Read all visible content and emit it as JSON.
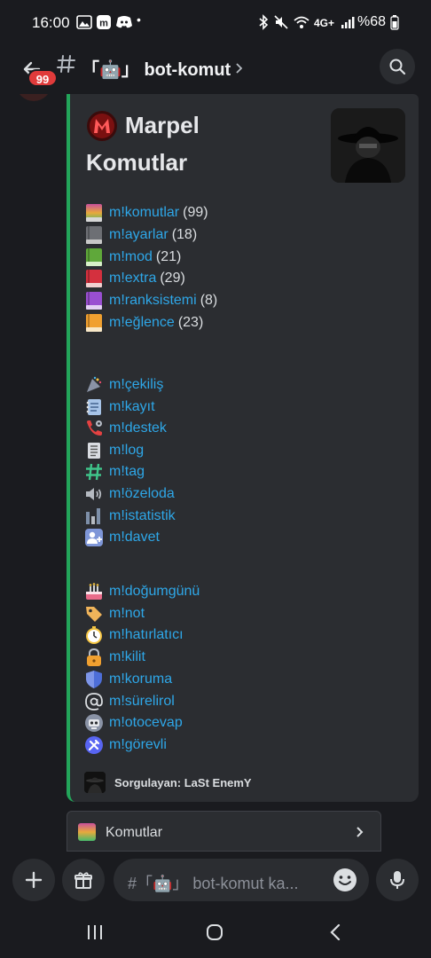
{
  "status_bar": {
    "time": "16:00",
    "battery": "%68"
  },
  "header": {
    "badge_count": "99",
    "channel_name": "「🤖」 bot-komut"
  },
  "embed": {
    "title_line1": "Marpel",
    "title_line2": "Komutlar",
    "commands_group1": [
      {
        "icon": "rainbow-book-icon",
        "label": "m!komutlar",
        "count": "(99)"
      },
      {
        "icon": "grey-book-icon",
        "label": "m!ayarlar",
        "count": "(18)"
      },
      {
        "icon": "green-book-icon",
        "label": "m!mod",
        "count": "(21)"
      },
      {
        "icon": "red-book-icon",
        "label": "m!extra",
        "count": "(29)"
      },
      {
        "icon": "purple-book-icon",
        "label": "m!ranksistemi",
        "count": "(8)"
      },
      {
        "icon": "orange-book-icon",
        "label": "m!eğlence",
        "count": "(23)"
      }
    ],
    "commands_group2": [
      {
        "icon": "giveaway-icon",
        "label": "m!çekiliş"
      },
      {
        "icon": "notepad-icon",
        "label": "m!kayıt"
      },
      {
        "icon": "support-phone-icon",
        "label": "m!destek"
      },
      {
        "icon": "log-list-icon",
        "label": "m!log"
      },
      {
        "icon": "hashtag-icon",
        "label": "m!tag"
      },
      {
        "icon": "speaker-icon",
        "label": "m!özeloda"
      },
      {
        "icon": "bar-chart-icon",
        "label": "m!istatistik"
      },
      {
        "icon": "invite-user-icon",
        "label": "m!davet"
      }
    ],
    "commands_group3": [
      {
        "icon": "cake-icon",
        "label": "m!doğumgünü"
      },
      {
        "icon": "tag-label-icon",
        "label": "m!not"
      },
      {
        "icon": "stopwatch-icon",
        "label": "m!hatırlatıcı"
      },
      {
        "icon": "padlock-icon",
        "label": "m!kilit"
      },
      {
        "icon": "shield-icon",
        "label": "m!koruma"
      },
      {
        "icon": "at-sign-icon",
        "label": "m!sürelirol"
      },
      {
        "icon": "robot-face-icon",
        "label": "m!otocevap"
      },
      {
        "icon": "tools-icon",
        "label": "m!görevli"
      }
    ],
    "footer_text": "Sorgulayan: LaSt EnemY",
    "accent_color": "#23a55a"
  },
  "select_menu": {
    "label": "Komutlar"
  },
  "input": {
    "placeholder": "#「🤖」 bot-komut ka..."
  },
  "colors": {
    "background": "#1a1b1f",
    "embed_bg": "#2b2d31",
    "link": "#2ea7e8",
    "badge": "#e03b3b"
  }
}
